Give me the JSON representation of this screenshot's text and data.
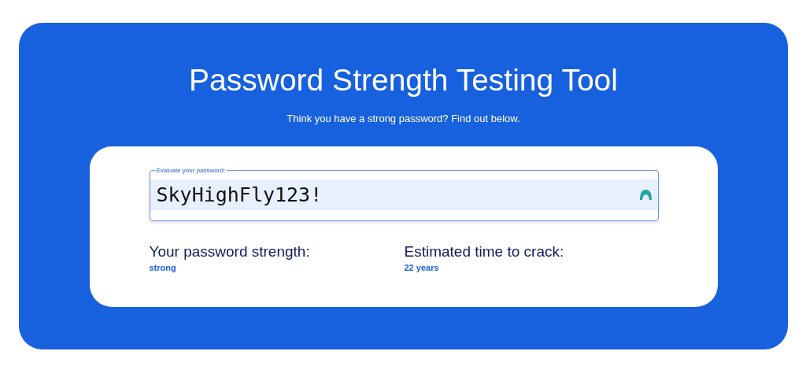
{
  "title": "Password Strength Testing Tool",
  "subtitle": "Think you have a strong password? Find out below.",
  "password_field": {
    "label": "Evaluate your password:",
    "value": "SkyHighFly123!"
  },
  "results": [
    {
      "label": "Your password strength:",
      "value": "strong"
    },
    {
      "label": "Estimated time to crack:",
      "value": "22 years"
    }
  ]
}
